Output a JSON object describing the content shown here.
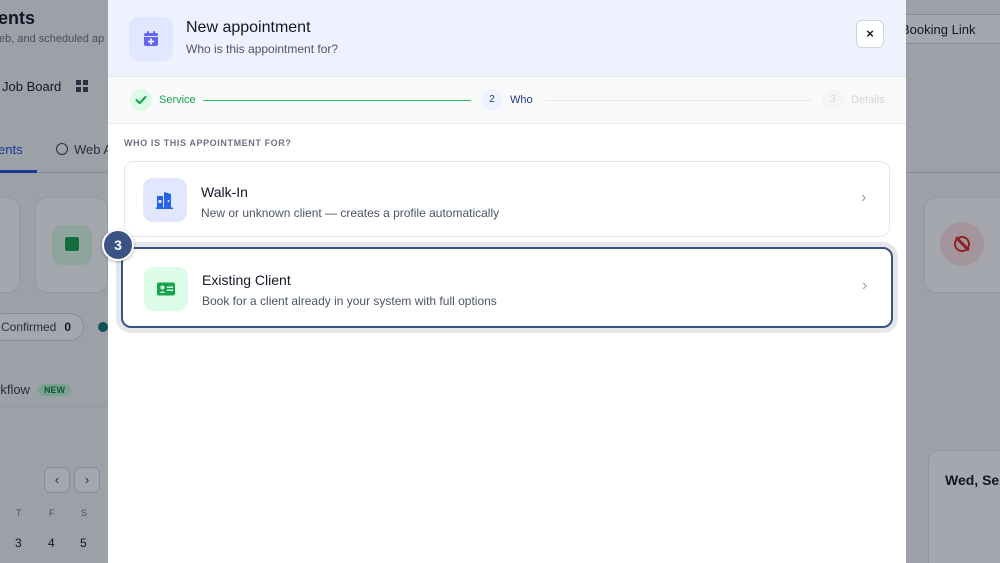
{
  "background": {
    "page_title": "ents",
    "page_subtitle": "eb, and scheduled ap",
    "booking_link_label": "Booking Link",
    "job_board_label": "Job Board",
    "tab_active_label": "ents",
    "tab_web_label": "Web A",
    "confirmed_label": "Confirmed",
    "confirmed_count": "0",
    "workflow_label": "rkflow",
    "new_badge": "NEW",
    "nav_prev": "‹",
    "nav_next": "›",
    "day_headers": [
      "T",
      "F",
      "S"
    ],
    "day_numbers": [
      "3",
      "4",
      "5"
    ],
    "date_heading": "Wed, Se"
  },
  "modal": {
    "title": "New appointment",
    "subtitle": "Who is this appointment for?",
    "close_icon": "×",
    "steps": [
      {
        "number": "✓",
        "label": "Service",
        "state": "done"
      },
      {
        "number": "2",
        "label": "Who",
        "state": "active"
      },
      {
        "number": "3",
        "label": "Details",
        "state": "todo"
      }
    ],
    "section_label": "WHO IS THIS APPOINTMENT FOR?",
    "options": [
      {
        "title": "Walk-In",
        "description": "New or unknown client — creates a profile automatically",
        "icon": "door-icon"
      },
      {
        "title": "Existing Client",
        "description": "Book for a client already in your system with full options",
        "icon": "id-card-icon"
      }
    ],
    "highlight_badge": "3"
  },
  "colors": {
    "accent": "#3b5382",
    "success": "#16a34a",
    "header_bg": "#eef2ff",
    "primary_blue": "#1e3a8a"
  }
}
